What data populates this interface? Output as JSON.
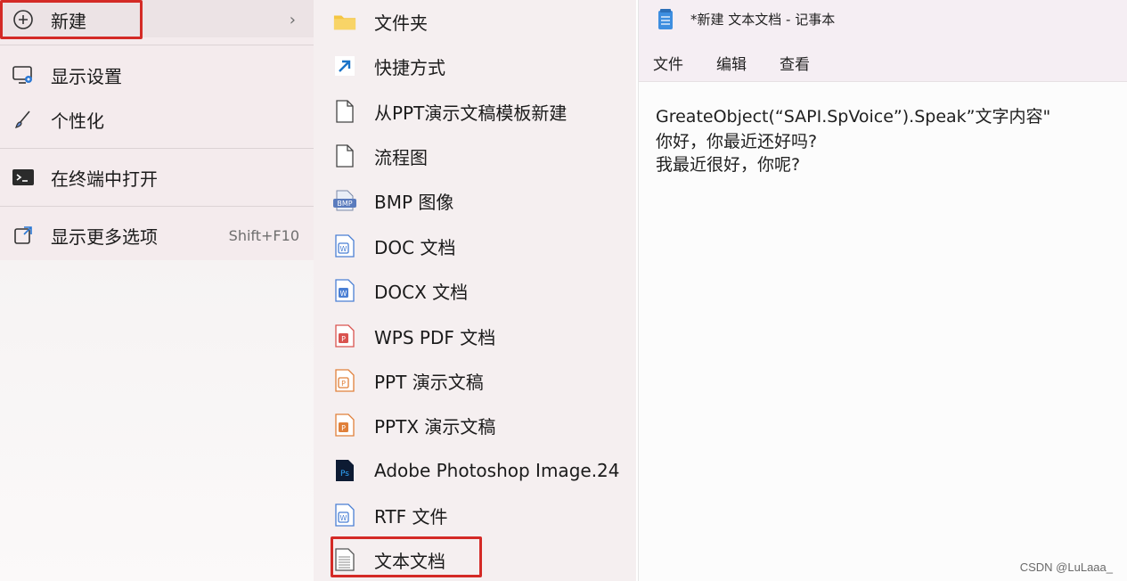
{
  "context_menu": {
    "items": [
      {
        "label": "新建",
        "icon": "plus-circle-icon",
        "has_submenu": true
      },
      {
        "label": "显示设置",
        "icon": "display-settings-icon"
      },
      {
        "label": "个性化",
        "icon": "brush-icon"
      },
      {
        "label": "在终端中打开",
        "icon": "terminal-icon"
      },
      {
        "label": "显示更多选项",
        "icon": "more-options-icon",
        "shortcut": "Shift+F10"
      }
    ],
    "chevron": "›"
  },
  "new_submenu": {
    "items": [
      {
        "label": "文件夹",
        "icon": "folder-icon"
      },
      {
        "label": "快捷方式",
        "icon": "shortcut-arrow-icon"
      },
      {
        "label": "从PPT演示文稿模板新建",
        "icon": "blank-file-icon"
      },
      {
        "label": "流程图",
        "icon": "blank-file-icon"
      },
      {
        "label": "BMP 图像",
        "icon": "bmp-icon"
      },
      {
        "label": "DOC 文档",
        "icon": "wps-doc-icon"
      },
      {
        "label": "DOCX 文档",
        "icon": "wps-docx-icon"
      },
      {
        "label": "WPS PDF 文档",
        "icon": "wps-pdf-icon"
      },
      {
        "label": "PPT 演示文稿",
        "icon": "wps-ppt-icon"
      },
      {
        "label": "PPTX 演示文稿",
        "icon": "wps-pptx-icon"
      },
      {
        "label": "Adobe Photoshop Image.24",
        "icon": "photoshop-icon"
      },
      {
        "label": "RTF 文件",
        "icon": "rtf-icon"
      },
      {
        "label": "文本文档",
        "icon": "text-document-icon"
      }
    ]
  },
  "notepad": {
    "title": "*新建 文本文档 - 记事本",
    "menu": [
      "文件",
      "编辑",
      "查看"
    ],
    "lines": [
      "GreateObject(“SAPI.SpVoice”).Speak”文字内容\"",
      "你好，你最近还好吗?",
      "我最近很好，你呢?"
    ]
  },
  "highlight_color": "#d42a26",
  "watermark": "CSDN @LuLaaa_"
}
